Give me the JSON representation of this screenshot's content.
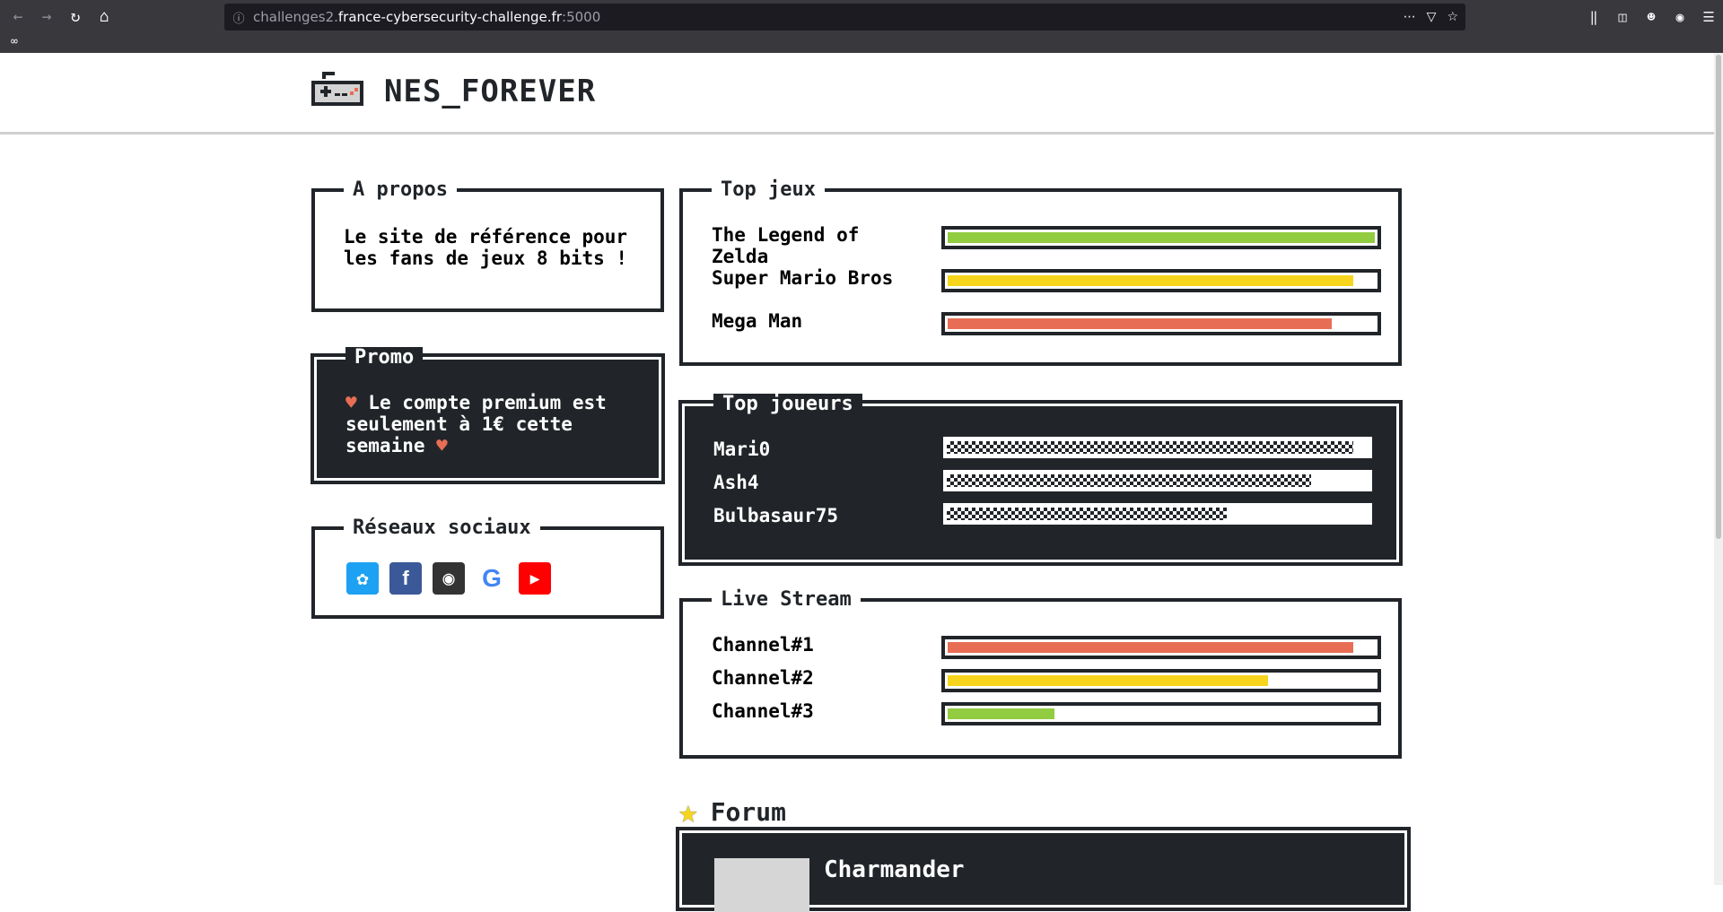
{
  "browser": {
    "url_subdomain": "challenges2.",
    "url_domain": "france-cybersecurity-challenge.fr",
    "url_port": ":5000",
    "bookmark_icon": "mask-icon"
  },
  "site": {
    "title": "NES_FOREVER",
    "logo_icon": "gamepad-icon"
  },
  "about": {
    "legend": "A propos",
    "text": "Le site de référence pour les fans de jeux 8 bits !"
  },
  "promo": {
    "legend": "Promo",
    "heart": "♥",
    "text": "Le compte premium est seulement à 1€ cette semaine"
  },
  "social": {
    "legend": "Réseaux sociaux",
    "icons": [
      "twitter-icon",
      "facebook-icon",
      "github-icon",
      "google-icon",
      "youtube-icon"
    ]
  },
  "top_games": {
    "legend": "Top jeux",
    "rows": [
      {
        "label": "The Legend of Zelda",
        "value": 1.0,
        "color": "#92cc41"
      },
      {
        "label": "Super Mario Bros",
        "value": 0.95,
        "color": "#f7d51d"
      },
      {
        "label": "Mega Man",
        "value": 0.9,
        "color": "#e76e55"
      }
    ]
  },
  "top_players": {
    "legend": "Top joueurs",
    "rows": [
      {
        "label": "Mari0",
        "value": 0.96
      },
      {
        "label": "Ash4",
        "value": 0.86
      },
      {
        "label": "Bulbasaur75",
        "value": 0.66
      }
    ]
  },
  "live_stream": {
    "legend": "Live Stream",
    "rows": [
      {
        "label": "Channel#1",
        "value": 0.95,
        "color": "#e76e55"
      },
      {
        "label": "Channel#2",
        "value": 0.75,
        "color": "#f7d51d"
      },
      {
        "label": "Channel#3",
        "value": 0.25,
        "color": "#92cc41"
      }
    ]
  },
  "forum": {
    "title": "Forum",
    "first_post_user": "Charmander"
  }
}
